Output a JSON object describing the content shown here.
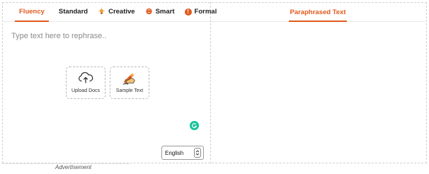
{
  "modes": {
    "fluency": "Fluency",
    "standard": "Standard",
    "creative": "Creative",
    "smart": "Smart",
    "formal": "Formal"
  },
  "output_tab": "Paraphrased Text",
  "input": {
    "placeholder": "Type text here to rephrase..",
    "value": ""
  },
  "actions": {
    "upload": "Upload Docs",
    "sample": "Sample Text"
  },
  "language": {
    "selected": "English"
  },
  "advertisement": "Advertisement",
  "colors": {
    "accent": "#e05a1c",
    "grammarly": "#15c39a"
  }
}
